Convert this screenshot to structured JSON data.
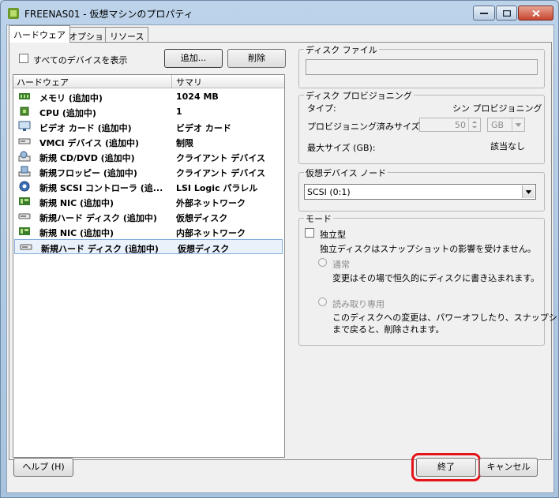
{
  "window": {
    "title": "FREENAS01 - 仮想マシンのプロパティ"
  },
  "tabs": [
    {
      "label": "ハードウェア"
    },
    {
      "label": "オプション"
    },
    {
      "label": "リソース"
    }
  ],
  "hardware_panel": {
    "show_all_label": "すべてのデバイスを表示",
    "show_all_checked": false,
    "add_label": "追加...",
    "remove_label": "削除",
    "columns": {
      "hardware": "ハードウェア",
      "summary": "サマリ"
    },
    "rows": [
      {
        "name": "メモリ (追加中)",
        "summary": "1024 MB",
        "icon": "memory-icon"
      },
      {
        "name": "CPU (追加中)",
        "summary": "1",
        "icon": "cpu-icon"
      },
      {
        "name": "ビデオ カード (追加中)",
        "summary": "ビデオ カード",
        "icon": "video-card-icon"
      },
      {
        "name": "VMCI デバイス (追加中)",
        "summary": "制限",
        "icon": "vmci-device-icon"
      },
      {
        "name": "新規 CD/DVD (追加中)",
        "summary": "クライアント デバイス",
        "icon": "cd-dvd-icon"
      },
      {
        "name": "新規フロッピー (追加中)",
        "summary": "クライアント デバイス",
        "icon": "floppy-icon"
      },
      {
        "name": "新規 SCSI コントローラ (追...",
        "summary": "LSI Logic パラレル",
        "icon": "scsi-controller-icon"
      },
      {
        "name": "新規 NIC (追加中)",
        "summary": "外部ネットワーク",
        "icon": "nic-icon"
      },
      {
        "name": "新規ハード ディスク (追加中)",
        "summary": "仮想ディスク",
        "icon": "hard-disk-icon"
      },
      {
        "name": "新規 NIC (追加中)",
        "summary": "内部ネットワーク",
        "icon": "nic-icon"
      },
      {
        "name": "新規ハード ディスク (追加中)",
        "summary": "仮想ディスク",
        "icon": "hard-disk-icon",
        "selected": true
      }
    ]
  },
  "disk_file": {
    "legend": "ディスク ファイル",
    "value": ""
  },
  "provisioning": {
    "legend": "ディスク プロビジョニング",
    "type_label": "タイプ:",
    "type_value": "シン プロビジョニング",
    "size_label": "プロビジョニング済みサイズ:",
    "size_value": "50",
    "size_unit": "GB",
    "max_label": "最大サイズ (GB):",
    "max_value": "該当なし"
  },
  "virtual_device_node": {
    "legend": "仮想デバイス ノード",
    "selected": "SCSI (0:1)"
  },
  "mode": {
    "legend": "モード",
    "independent_label": "独立型",
    "independent_checked": false,
    "independent_desc": "独立ディスクはスナップショットの影響を受けません。",
    "normal_label": "通常",
    "normal_desc": "変更はその場で恒久的にディスクに書き込まれます。",
    "readonly_label": "読み取り専用",
    "readonly_desc_line1": "このディスクへの変更は、パワーオフしたり、スナップショット",
    "readonly_desc_line2": "まで戻ると、削除されます。"
  },
  "footer": {
    "help_label": "ヘルプ (H)",
    "finish_label": "終了",
    "cancel_label": "キャンセル"
  },
  "colors": {
    "highlight_outline": "#e3141a",
    "selection_bg": "#e9f1fb",
    "selection_border": "#84acdd"
  }
}
